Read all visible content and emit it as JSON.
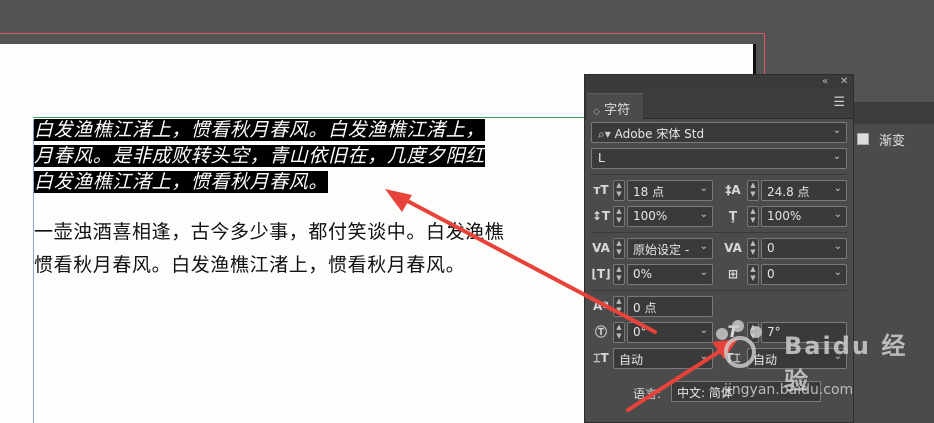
{
  "document": {
    "lines": [
      {
        "text": "白发渔樵江渚上，惯看秋月春风。白发渔樵江渚上，",
        "style": "selected"
      },
      {
        "text": "月春风。是非成败转头空，青山依旧在，几度夕阳红",
        "style": "selected"
      },
      {
        "text": "白发渔樵江渚上，惯看秋月春风。",
        "style": "selected"
      },
      {
        "text": "一壶浊酒喜相逢，古今多少事，都付笑谈中。白发渔樵",
        "style": "normal"
      },
      {
        "text": "惯看秋月春风。白发渔樵江渚上，惯看秋月春风。",
        "style": "normal"
      }
    ]
  },
  "panel": {
    "tab_label": "字符",
    "font_family": "Adobe 宋体 Std",
    "font_style": "L",
    "font_size": "18 点",
    "leading": "24.8 点",
    "vertical_scale": "100%",
    "horizontal_scale": "100%",
    "kerning": "原始设定 -",
    "tracking": "0",
    "tsume": "0%",
    "mojikumi": "0",
    "baseline_shift": "0 点",
    "rotation": "0°",
    "skew": "7°",
    "auto_left": "自动",
    "auto_right": "自动",
    "language_label": "语言:",
    "language_value": "中文: 简体"
  },
  "gradient_panel": {
    "label": "渐变"
  },
  "watermark": {
    "brand": "Baidu 经验",
    "url": "jingyan.baidu.com"
  },
  "colors": {
    "workspace": "#535353",
    "panel": "#4b4b4b",
    "selection": "#000000",
    "arrow": "#e8433a",
    "bleed": "#d9596a"
  }
}
